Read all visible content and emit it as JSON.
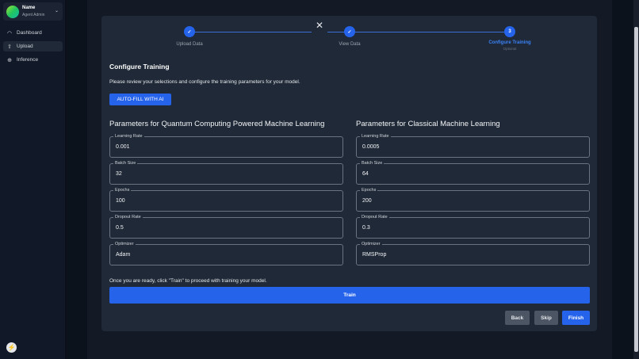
{
  "sidebar": {
    "user": {
      "name": "Name",
      "role": "Agent Admin"
    },
    "items": [
      {
        "label": "Dashboard",
        "icon": "gauge-icon"
      },
      {
        "label": "Upload",
        "icon": "upload-icon"
      },
      {
        "label": "Inference",
        "icon": "brain-icon"
      }
    ]
  },
  "stepper": {
    "steps": [
      {
        "label": "Upload Data",
        "mark": "✓"
      },
      {
        "label": "View Data",
        "mark": "✓"
      },
      {
        "label": "Configure Training",
        "mark": "3",
        "sub": "Optional"
      }
    ]
  },
  "main": {
    "title": "Configure Training",
    "description": "Please review your selections and configure the training parameters for your model.",
    "autofill": "AUTO-FILL WITH AI",
    "quantum": {
      "title": "Parameters for Quantum Computing Powered Machine Learning",
      "fields": [
        {
          "label": "Learning Rate",
          "value": "0.001"
        },
        {
          "label": "Batch Size",
          "value": "32"
        },
        {
          "label": "Epochs",
          "value": "100"
        },
        {
          "label": "Dropout Rate",
          "value": "0.5"
        },
        {
          "label": "Optimizer",
          "value": "Adam"
        }
      ]
    },
    "classical": {
      "title": "Parameters for Classical Machine Learning",
      "fields": [
        {
          "label": "Learning Rate",
          "value": "0.0005"
        },
        {
          "label": "Batch Size",
          "value": "64"
        },
        {
          "label": "Epochs",
          "value": "200"
        },
        {
          "label": "Dropout Rate",
          "value": "0.3"
        },
        {
          "label": "Optimizer",
          "value": "RMSProp"
        }
      ]
    },
    "ready": "Once you are ready, click \"Train\" to proceed with training your model.",
    "train": "Train",
    "back": "Back",
    "skip": "Skip",
    "finish": "Finish"
  }
}
